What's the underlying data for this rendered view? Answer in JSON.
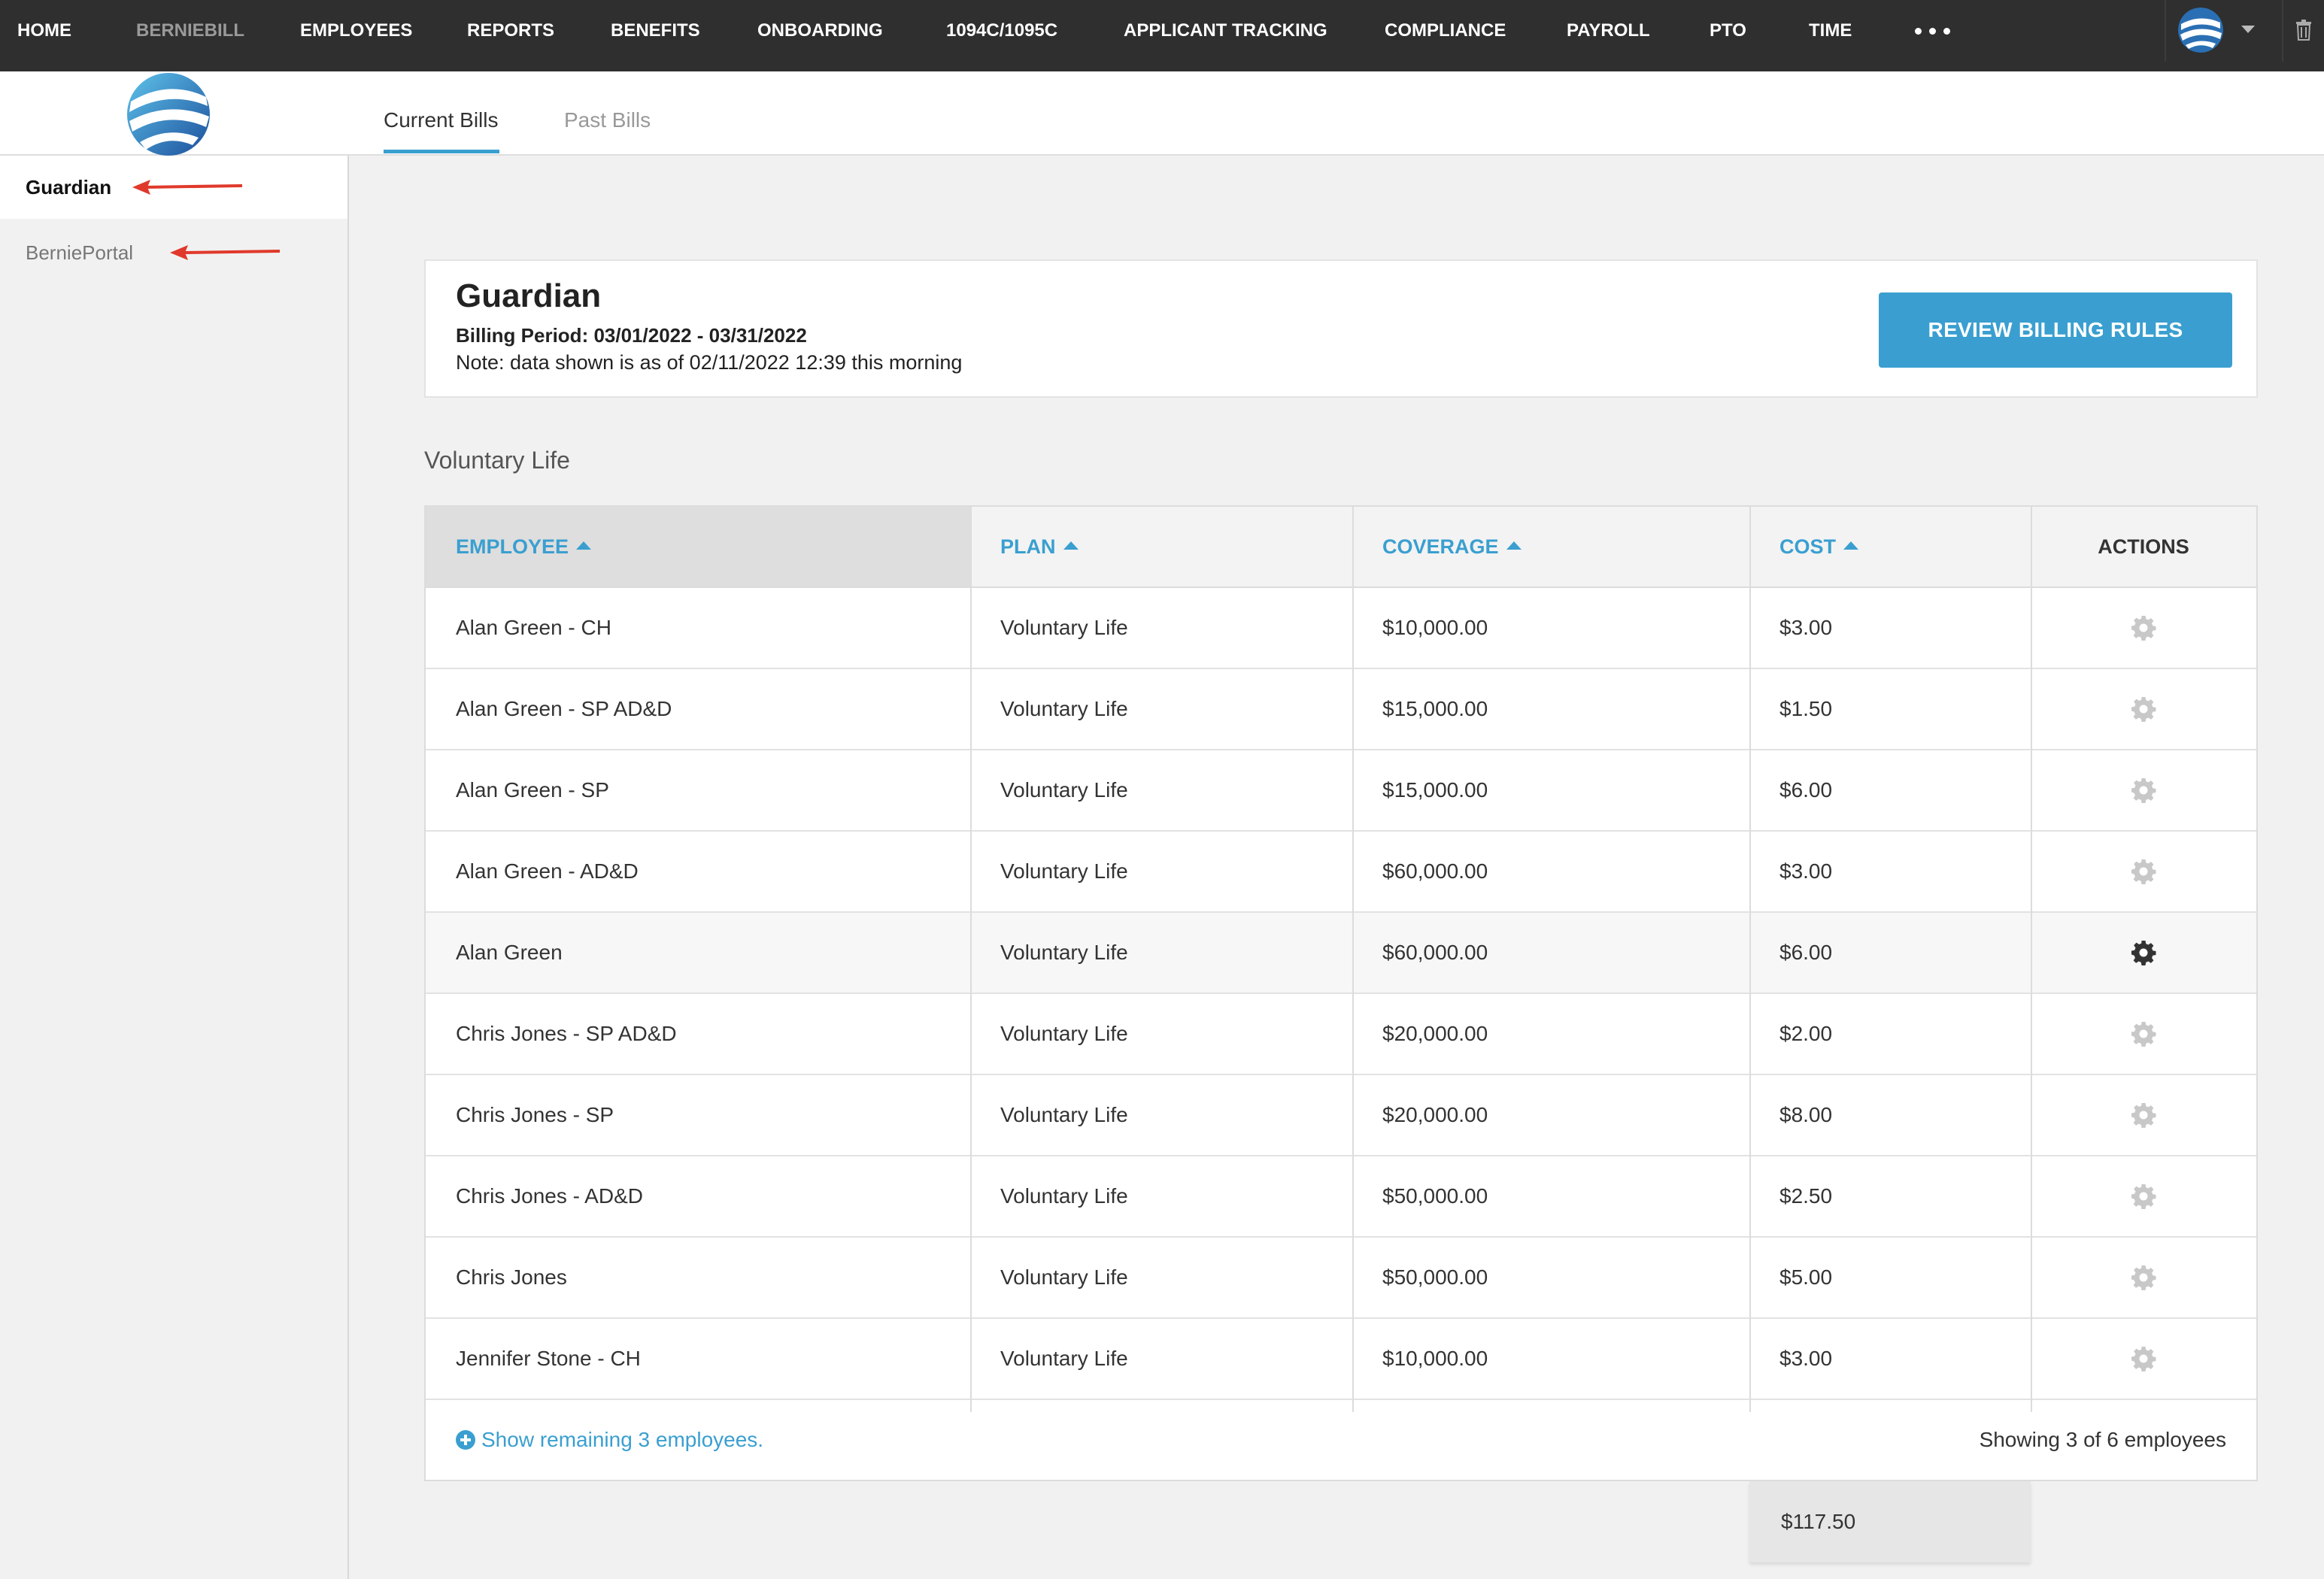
{
  "nav": {
    "items": [
      "HOME",
      "BERNIEBILL",
      "EMPLOYEES",
      "REPORTS",
      "BENEFITS",
      "ONBOARDING",
      "1094C/1095C",
      "APPLICANT TRACKING",
      "COMPLIANCE",
      "PAYROLL",
      "PTO",
      "TIME"
    ],
    "active": "BERNIEBILL",
    "more_icon": "more-dots-icon",
    "user_icon": "avatar-globe-icon",
    "menu_icon": "caret-down-icon",
    "trash_icon": "trash-icon"
  },
  "tabs": {
    "current": "Current Bills",
    "past": "Past Bills"
  },
  "sidebar": {
    "items": [
      "Guardian",
      "BerniePortal"
    ],
    "selected": "Guardian"
  },
  "header": {
    "title": "Guardian",
    "billing_period": "Billing Period: 03/01/2022 - 03/31/2022",
    "note": "Note: data shown is as of 02/11/2022 12:39 this morning",
    "review_button": "REVIEW BILLING RULES"
  },
  "section": {
    "title": "Voluntary Life"
  },
  "table": {
    "columns": {
      "employee": "EMPLOYEE",
      "plan": "PLAN",
      "coverage": "COVERAGE",
      "cost": "COST",
      "actions": "ACTIONS"
    },
    "rows": [
      {
        "employee": "Alan Green - CH",
        "plan": "Voluntary Life",
        "coverage": "$10,000.00",
        "cost": "$3.00"
      },
      {
        "employee": "Alan Green - SP AD&D",
        "plan": "Voluntary Life",
        "coverage": "$15,000.00",
        "cost": "$1.50"
      },
      {
        "employee": "Alan Green - SP",
        "plan": "Voluntary Life",
        "coverage": "$15,000.00",
        "cost": "$6.00"
      },
      {
        "employee": "Alan Green - AD&D",
        "plan": "Voluntary Life",
        "coverage": "$60,000.00",
        "cost": "$3.00"
      },
      {
        "employee": "Alan Green",
        "plan": "Voluntary Life",
        "coverage": "$60,000.00",
        "cost": "$6.00"
      },
      {
        "employee": "Chris Jones - SP AD&D",
        "plan": "Voluntary Life",
        "coverage": "$20,000.00",
        "cost": "$2.00"
      },
      {
        "employee": "Chris Jones - SP",
        "plan": "Voluntary Life",
        "coverage": "$20,000.00",
        "cost": "$8.00"
      },
      {
        "employee": "Chris Jones - AD&D",
        "plan": "Voluntary Life",
        "coverage": "$50,000.00",
        "cost": "$2.50"
      },
      {
        "employee": "Chris Jones",
        "plan": "Voluntary Life",
        "coverage": "$50,000.00",
        "cost": "$5.00"
      },
      {
        "employee": "Jennifer Stone - CH",
        "plan": "Voluntary Life",
        "coverage": "$10,000.00",
        "cost": "$3.00"
      }
    ],
    "hover_row": 4,
    "show_remaining": "Show remaining 3 employees.",
    "showing": "Showing 3 of 6 employees",
    "total": "$117.50"
  },
  "colors": {
    "accent": "#3a9fd0",
    "nav_bg": "#2f2f2f",
    "annotation_arrow": "#e0392b"
  }
}
